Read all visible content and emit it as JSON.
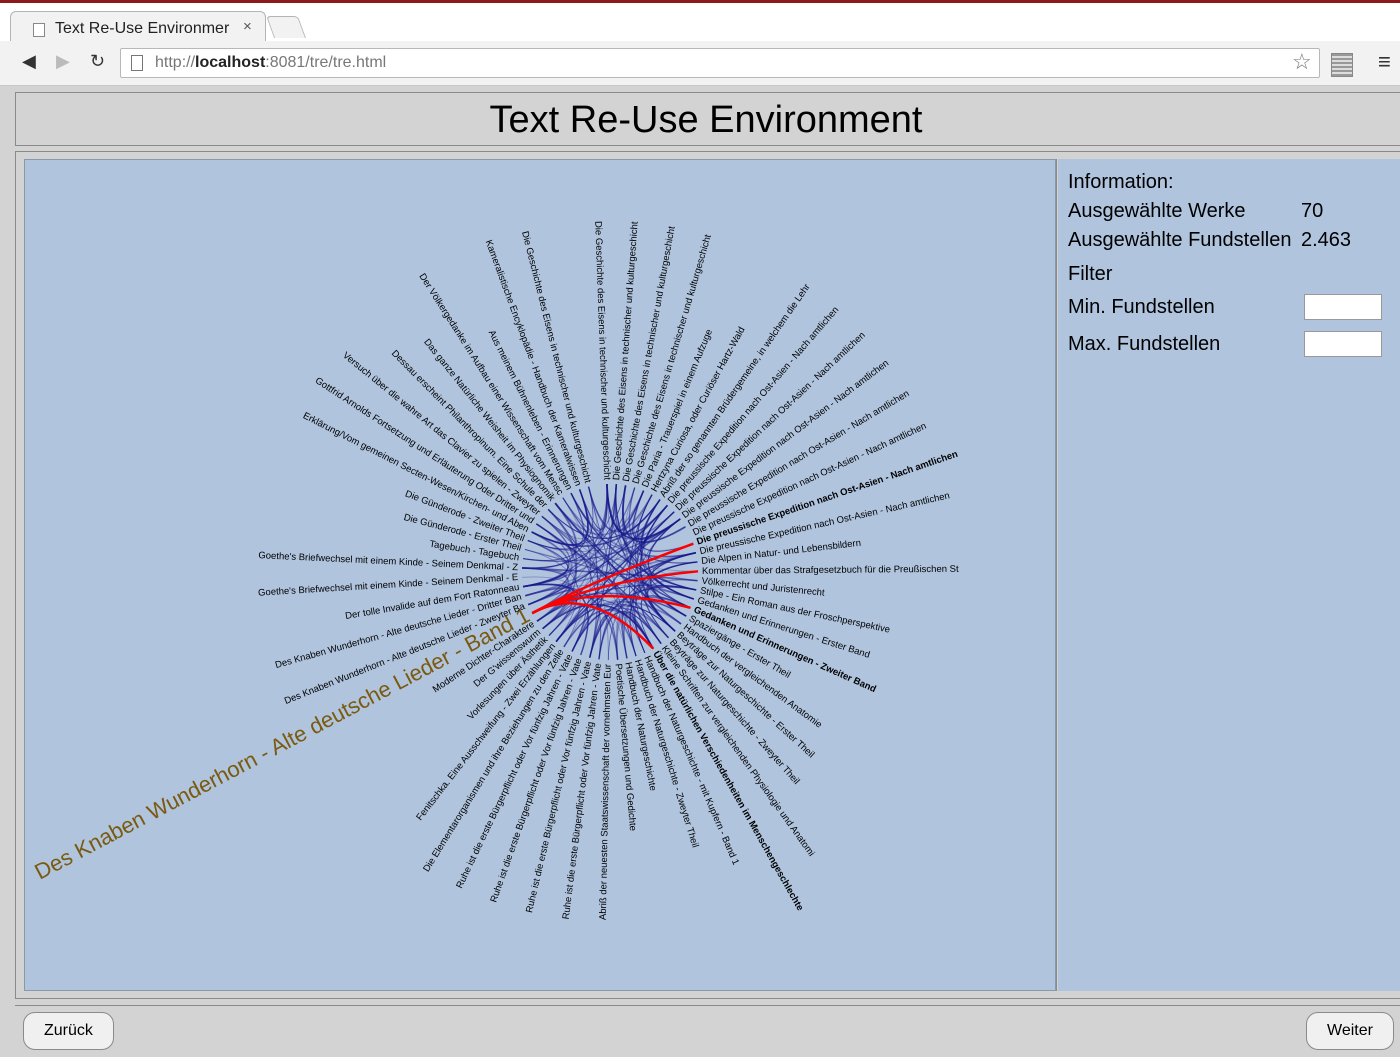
{
  "browser": {
    "tab_title": "Text Re-Use Environmer",
    "close_glyph": "×",
    "url_prefix": "http://",
    "url_host": "localhost",
    "url_rest": ":8081/tre/tre.html"
  },
  "page": {
    "title": "Text Re-Use Environment"
  },
  "info": {
    "heading": "Information:",
    "works_label": "Ausgewählte Werke",
    "works_value": "70",
    "passages_label": "Ausgewählte Fundstellen",
    "passages_value": "2.463",
    "filter_label": "Filter",
    "min_label": "Min. Fundstellen",
    "max_label": "Max. Fundstellen",
    "min_value": "",
    "max_value": ""
  },
  "footer": {
    "back_label": "Zurück",
    "next_label": "Weiter"
  },
  "visualization": {
    "type": "chord-diagram",
    "colors": {
      "link_default": "#1a1a8c",
      "link_selected": "#ff0000",
      "label": "#000000",
      "highlight_label": "#7a5a10"
    },
    "labels": [
      "Die Geschichte des Eisens in technischer und kulturgeschicht",
      "Die Geschichte des Eisens in technischer und kulturgeschicht",
      "Die Geschichte des Eisens in technischer und kulturgeschicht",
      "Die Geschichte des Eisens in technischer und kulturgeschicht",
      "Die Paria - Trauerspiel in einem Aufzuge",
      "Hertzyna Curiosa, oder Curiöser Hartz-Wald",
      "Abriß der so genannten Brüdergemeine, in welchem die Lehr",
      "Die preussische Expedition nach Ost-Asien - Nach amtlichen",
      "Die preussische Expedition nach Ost-Asien - Nach amtlichen",
      "Die preussische Expedition nach Ost-Asien - Nach amtlichen",
      "Die preussische Expedition nach Ost-Asien - Nach amtlichen",
      "Die preussische Expedition nach Ost-Asien - Nach amtlichen",
      "Die preussische Expedition nach Ost-Asien - Nach amtlichen",
      "Die preussische Expedition nach Ost-Asien - Nach amtlichen",
      "Die Alpen in Natur- und Lebensbildern",
      "Kommentar über das Strafgesetzbuch für die Preußischen St",
      "Völkerrecht und Juristenrecht",
      "Stilpe - Ein Roman aus der Froschperspektive",
      "Gedanken und Erinnerungen - Erster Band",
      "Gedanken und Erinnerungen - Zweiter Band",
      "Spaziergänge - Erster Theil",
      "Handbuch der vergleichenden Anatomie",
      "Beyträge zur Naturgeschichte - Erster Theil",
      "Beyträge zur Naturgeschichte - Zweyter Theil",
      "Kleine Schriften zur vergleichenden Physiologie und Anatomi",
      "Über die natürlichen Verschiedenheiten im Menschengeschlechte",
      "Handbuch der Naturgeschichte - mit Kupfern - Band 1",
      "Handbuch der Naturgeschichte - Zweyter Theil",
      "Handbuch der Naturgeschichte",
      "Poetische Übersetzungen und Gedichte",
      "Abriß der neuesten Staatswissenschaft der vornehmsten Eur",
      "Ruhe ist die erste Bürgerpflicht oder Vor fünfzig Jahren - Vate",
      "Ruhe ist die erste Bürgerpflicht oder Vor fünfzig Jahren - Vate",
      "Ruhe ist die erste Bürgerpflicht oder Vor fünfzig Jahren - Vate",
      "Ruhe ist die erste Bürgerpflicht oder Vor fünfzig Jahren - Vate",
      "Die Elementarorganismen und ihre Beziehungen zu den Zelle",
      "Fenitschka. Eine Ausschweifung - Zwei Erzählungen",
      "Vorlesungen über Ästhetik",
      "Der G'wissenswurm",
      "Moderne Dichter-Charaktere",
      "Des Knaben Wunderhorn - Alte deutsche Lieder - Band 1",
      "Des Knaben Wunderhorn - Alte deutsche Lieder - Zweyter Ba",
      "Des Knaben Wunderhorn - Alte deutsche Lieder - Dritter Ban",
      "Der tolle Invalide auf dem Fort Ratonneau",
      "Goethe's Briefwechsel mit einem Kinde - Seinem Denkmal - E",
      "Goethe's Briefwechsel mit einem Kinde - Seinem Denkmal - Z",
      "Tagebuch - Tagebuch",
      "Die Günderode - Erster Theil",
      "Die Günderode - Zweiter Theil",
      "Erklärung/Vom gemeinen Secten-Wesen/Kirchen- und Aben",
      "Gottfrid Arnolds Fortsetzung und Erläuterung Oder Dritter und",
      "Versuch über die wahre Art das Clavier zu spielen - Zweyter",
      "Dessau erscheint Philanthropinum. Eine Schule der",
      "Das ganze Natürliche Weisheit im Physiognomik",
      "Der Völkergedanke im Aufbau einer Wissenschaft vom Mensc",
      "Aus meinem Bühnenleben - Erinnerungen",
      "Kameralistische Encyklopädie - Handbuch der Kameralwissen",
      "Die Geschichte des Eisens in technischer und kulturgeschicht"
    ]
  }
}
